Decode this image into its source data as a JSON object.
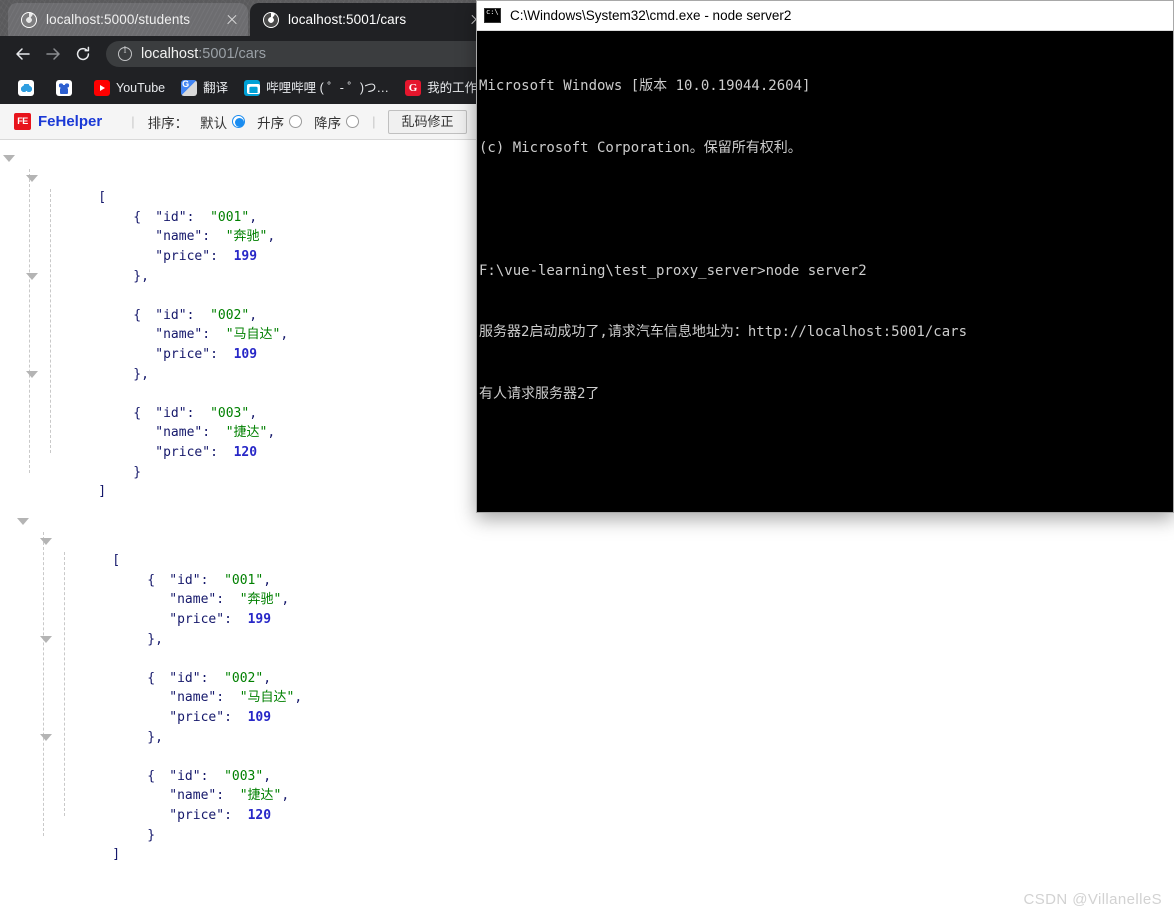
{
  "browser": {
    "tabs": [
      {
        "title": "localhost:5000/students",
        "active": false,
        "favicon": "globe-icon"
      },
      {
        "title": "localhost:5001/cars",
        "active": true,
        "favicon": "globe-icon"
      }
    ],
    "toolbar": {
      "back_icon": "back-arrow-icon",
      "forward_icon": "forward-arrow-icon",
      "reload_icon": "reload-icon",
      "site_info_icon": "info-circle-icon",
      "url_host": "localhost",
      "url_path": ":5001/cars",
      "url_full": "localhost:5001/cars"
    },
    "bookmarks": [
      {
        "label": "",
        "icon": "cloud-icon"
      },
      {
        "label": "",
        "icon": "baidu-icon"
      },
      {
        "label": "YouTube",
        "icon": "youtube-icon"
      },
      {
        "label": "翻译",
        "icon": "google-translate-icon"
      },
      {
        "label": "哔哩哔哩 ( ゜- ゜)つ…",
        "icon": "bilibili-icon"
      },
      {
        "label": "我的工作台 -",
        "icon": "gitee-icon"
      }
    ]
  },
  "fehelper": {
    "logo_mark": "FE",
    "logo_name": "FeHelper",
    "sort_label": "排序：",
    "options": [
      {
        "label": "默认",
        "selected": true
      },
      {
        "label": "升序",
        "selected": false
      },
      {
        "label": "降序",
        "selected": false
      }
    ],
    "fix_button": "乱码修正",
    "separator": "|"
  },
  "json_viewer": {
    "blocks": [
      {
        "name": "cars-json-top",
        "open_bracket": "[",
        "close_bracket": "]",
        "items": [
          {
            "id_key": "\"id\"",
            "id_value": "\"001\"",
            "name_key": "\"name\"",
            "name_value": "\"奔驰\"",
            "price_key": "\"price\"",
            "price_value": "199",
            "open": "{",
            "close": "},"
          },
          {
            "id_key": "\"id\"",
            "id_value": "\"002\"",
            "name_key": "\"name\"",
            "name_value": "\"马自达\"",
            "price_key": "\"price\"",
            "price_value": "109",
            "open": "{",
            "close": "},"
          },
          {
            "id_key": "\"id\"",
            "id_value": "\"003\"",
            "name_key": "\"name\"",
            "name_value": "\"捷达\"",
            "price_key": "\"price\"",
            "price_value": "120",
            "open": "{",
            "close": "}"
          }
        ]
      },
      {
        "name": "cars-json-bottom",
        "open_bracket": "[",
        "close_bracket": "]",
        "items": [
          {
            "id_key": "\"id\"",
            "id_value": "\"001\"",
            "name_key": "\"name\"",
            "name_value": "\"奔驰\"",
            "price_key": "\"price\"",
            "price_value": "199",
            "open": "{",
            "close": "},"
          },
          {
            "id_key": "\"id\"",
            "id_value": "\"002\"",
            "name_key": "\"name\"",
            "name_value": "\"马自达\"",
            "price_key": "\"price\"",
            "price_value": "109",
            "open": "{",
            "close": "},"
          },
          {
            "id_key": "\"id\"",
            "id_value": "\"003\"",
            "name_key": "\"name\"",
            "name_value": "\"捷达\"",
            "price_key": "\"price\"",
            "price_value": "120",
            "open": "{",
            "close": "}"
          }
        ]
      }
    ],
    "colon": ":",
    "colors": {
      "key": "#15186b",
      "string": "#008000",
      "number": "#2727c7"
    }
  },
  "cmd": {
    "title": "C:\\Windows\\System32\\cmd.exe - node  server2",
    "icon": "cmd-icon",
    "lines": [
      "Microsoft Windows [版本 10.0.19044.2604]",
      "(c) Microsoft Corporation。保留所有权利。",
      "",
      "F:\\vue-learning\\test_proxy_server>node server2",
      "服务器2启动成功了,请求汽车信息地址为：http://localhost:5001/cars",
      "有人请求服务器2了"
    ]
  },
  "watermark": "CSDN @VillanelleS"
}
